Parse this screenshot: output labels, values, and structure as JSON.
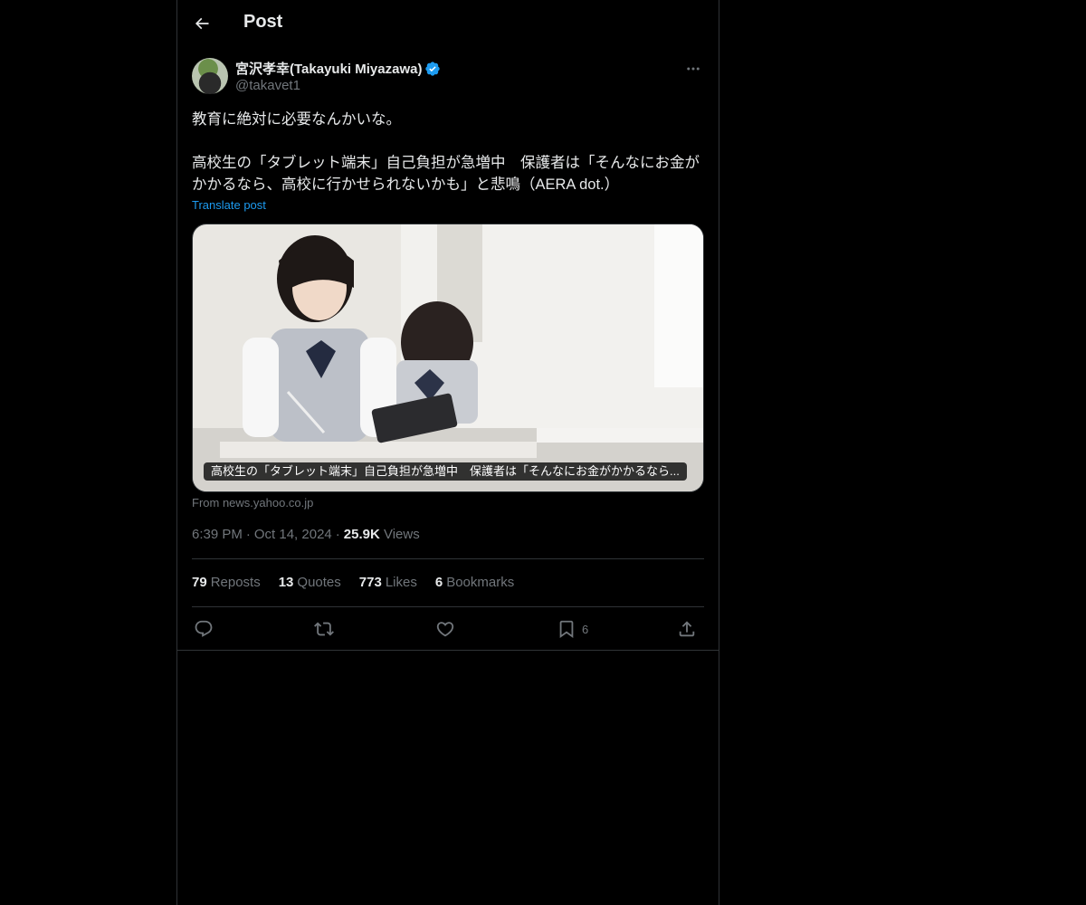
{
  "header": {
    "title": "Post",
    "back_icon": "arrow-left-icon"
  },
  "author": {
    "name": "宮沢孝幸(Takayuki Miyazawa)",
    "handle": "@takavet1",
    "verified_color": "#1d9bf0"
  },
  "post": {
    "line1": "教育に絶対に必要なんかいな。",
    "line2": "高校生の「タブレット端末」自己負担が急増中　保護者は「そんなにお金がかかるなら、高校に行かせられないかも」と悲鳴（AERA dot.）",
    "translate_label": "Translate post"
  },
  "card": {
    "caption": "高校生の「タブレット端末」自己負担が急増中　保護者は「そんなにお金がかかるなら...",
    "source": "From news.yahoo.co.jp"
  },
  "meta": {
    "time": "6:39 PM",
    "date": "Oct 14, 2024",
    "views_count": "25.9K",
    "views_label": "Views"
  },
  "stats": {
    "reposts_count": "79",
    "reposts_label": "Reposts",
    "quotes_count": "13",
    "quotes_label": "Quotes",
    "likes_count": "773",
    "likes_label": "Likes",
    "bookmarks_count": "6",
    "bookmarks_label": "Bookmarks"
  },
  "actions": {
    "bookmark_count": "6"
  },
  "colors": {
    "background": "#000000",
    "text": "#e7e9ea",
    "muted": "#71767b",
    "accent": "#1d9bf0",
    "border": "#2f3336"
  }
}
